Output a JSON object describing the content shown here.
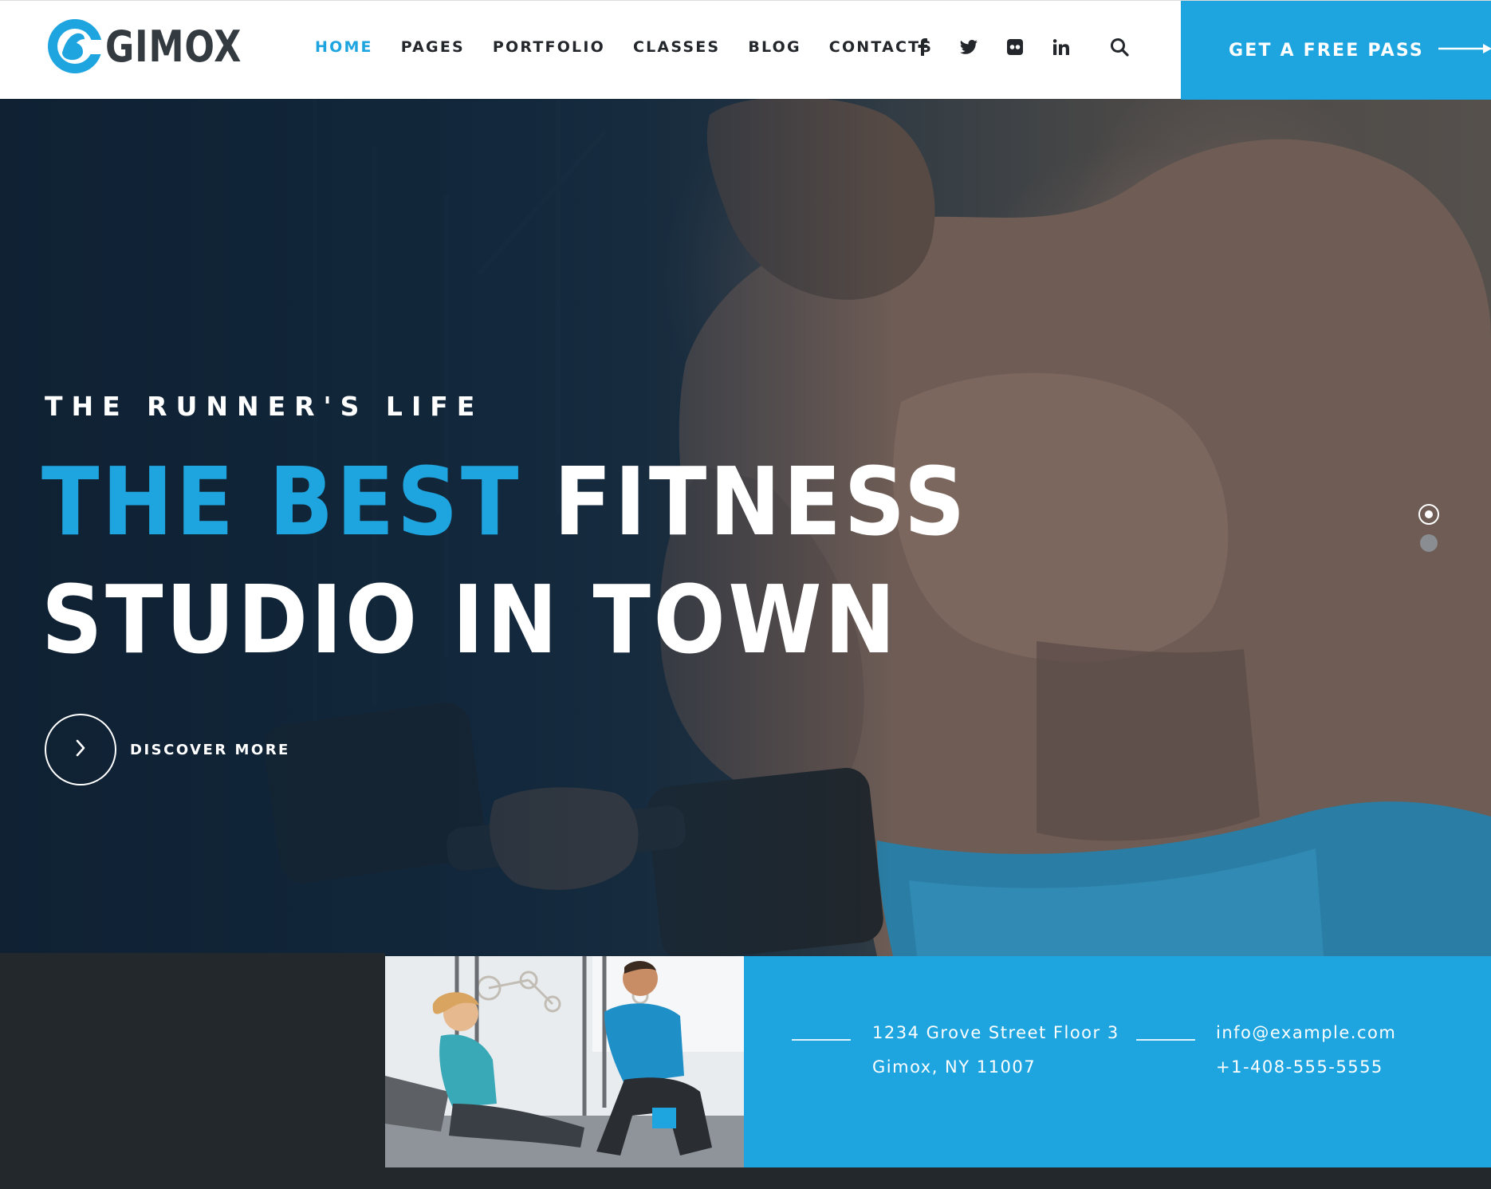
{
  "brand": {
    "name": "GIMOX"
  },
  "nav": {
    "items": [
      {
        "label": "HOME",
        "active": true
      },
      {
        "label": "PAGES",
        "active": false
      },
      {
        "label": "PORTFOLIO",
        "active": false
      },
      {
        "label": "CLASSES",
        "active": false
      },
      {
        "label": "BLOG",
        "active": false
      },
      {
        "label": "CONTACTS",
        "active": false
      }
    ]
  },
  "socials": [
    "facebook-icon",
    "twitter-icon",
    "flickr-icon",
    "linkedin-icon"
  ],
  "cta": {
    "label": "GET A FREE PASS"
  },
  "hero": {
    "kicker": "THE RUNNER'S LIFE",
    "headline_highlight": "THE BEST",
    "headline_rest_line1": " FITNESS",
    "headline_line2": "STUDIO IN TOWN",
    "discover_label": "DISCOVER MORE",
    "slides": {
      "count": 2,
      "active": 1
    }
  },
  "contact": {
    "address_line1": "1234 Grove Street Floor 3",
    "address_line2": "Gimox, NY 11007",
    "email": "info@example.com",
    "phone": "+1-408-555-5555"
  },
  "colors": {
    "accent": "#1ea5e0",
    "dark": "#23282d",
    "text_dark": "#23272b"
  }
}
